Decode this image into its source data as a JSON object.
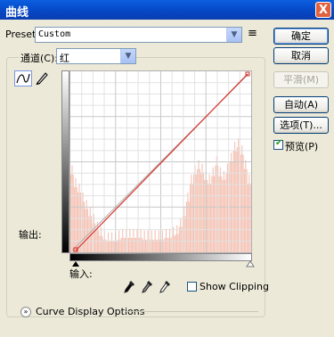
{
  "window": {
    "title": "曲线",
    "close_glyph": "X"
  },
  "preset": {
    "label": "Preset:",
    "value": "Custom",
    "menu_glyph": "≡"
  },
  "buttons": {
    "ok": "确定",
    "cancel": "取消",
    "smooth": "平滑(M)",
    "auto": "自动(A)",
    "options": "选项(T)..."
  },
  "preview": {
    "label": "预览(P)",
    "checked": true
  },
  "channel": {
    "label": "通道(C):",
    "value": "红"
  },
  "graph": {
    "output_label": "输出:",
    "input_label": "输入:",
    "curve_color": "#d8332a",
    "histogram_color": "#f4c2b4",
    "histogram": [
      0.45,
      0.38,
      0.35,
      0.3,
      0.26,
      0.22,
      0.18,
      0.14,
      0.11,
      0.09,
      0.08,
      0.08,
      0.08,
      0.09,
      0.1,
      0.1,
      0.1,
      0.1,
      0.1,
      0.1,
      0.09,
      0.09,
      0.09,
      0.09,
      0.09,
      0.09,
      0.1,
      0.1,
      0.11,
      0.12,
      0.16,
      0.22,
      0.3,
      0.4,
      0.45,
      0.48,
      0.46,
      0.42,
      0.4,
      0.44,
      0.5,
      0.44,
      0.42,
      0.46,
      0.52,
      0.58,
      0.6,
      0.56,
      0.48,
      0.4
    ]
  },
  "show_clipping": {
    "label": "Show Clipping",
    "checked": false
  },
  "curve_display_options": {
    "label": "Curve Display Options"
  },
  "icons": {
    "curve_tool": "curve-tool-icon",
    "pencil_tool": "pencil-tool-icon",
    "black_point": "eyedropper-black-icon",
    "gray_point": "eyedropper-gray-icon",
    "white_point": "eyedropper-white-icon"
  }
}
